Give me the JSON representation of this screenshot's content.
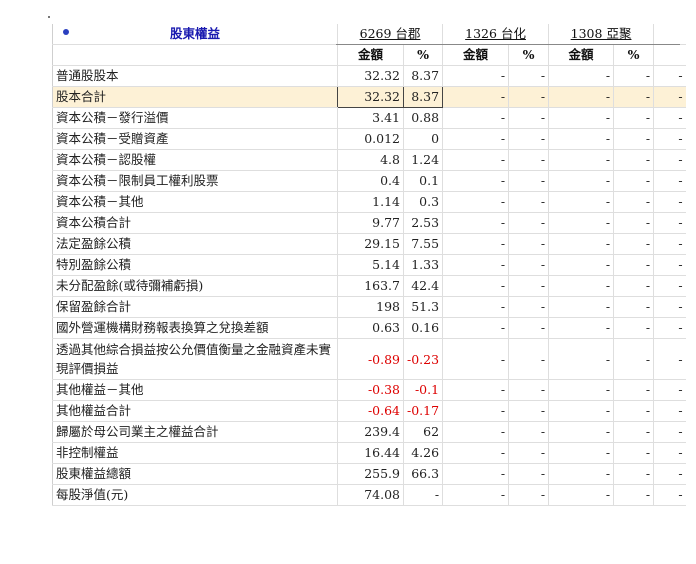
{
  "header": {
    "title": "股東權益",
    "companies": [
      "6269 台郡",
      "1326 台化",
      "1308 亞聚"
    ],
    "amount_label": "金額",
    "percent_label": "%"
  },
  "rows": [
    {
      "label": "普通股股本",
      "values": [
        "32.32",
        "8.37",
        "-",
        "-",
        "-",
        "-"
      ],
      "neg": false,
      "highlight": false
    },
    {
      "label": "股本合計",
      "values": [
        "32.32",
        "8.37",
        "-",
        "-",
        "-",
        "-"
      ],
      "neg": false,
      "highlight": true
    },
    {
      "label": "資本公積－發行溢價",
      "values": [
        "3.41",
        "0.88",
        "-",
        "-",
        "-",
        "-"
      ],
      "neg": false,
      "highlight": false
    },
    {
      "label": "資本公積－受贈資產",
      "values": [
        "0.012",
        "0",
        "-",
        "-",
        "-",
        "-"
      ],
      "neg": false,
      "highlight": false
    },
    {
      "label": "資本公積－認股權",
      "values": [
        "4.8",
        "1.24",
        "-",
        "-",
        "-",
        "-"
      ],
      "neg": false,
      "highlight": false
    },
    {
      "label": "資本公積－限制員工權利股票",
      "values": [
        "0.4",
        "0.1",
        "-",
        "-",
        "-",
        "-"
      ],
      "neg": false,
      "highlight": false
    },
    {
      "label": "資本公積－其他",
      "values": [
        "1.14",
        "0.3",
        "-",
        "-",
        "-",
        "-"
      ],
      "neg": false,
      "highlight": false
    },
    {
      "label": "資本公積合計",
      "values": [
        "9.77",
        "2.53",
        "-",
        "-",
        "-",
        "-"
      ],
      "neg": false,
      "highlight": false
    },
    {
      "label": "法定盈餘公積",
      "values": [
        "29.15",
        "7.55",
        "-",
        "-",
        "-",
        "-"
      ],
      "neg": false,
      "highlight": false
    },
    {
      "label": "特別盈餘公積",
      "values": [
        "5.14",
        "1.33",
        "-",
        "-",
        "-",
        "-"
      ],
      "neg": false,
      "highlight": false
    },
    {
      "label": "未分配盈餘(或待彌補虧損)",
      "values": [
        "163.7",
        "42.4",
        "-",
        "-",
        "-",
        "-"
      ],
      "neg": false,
      "highlight": false
    },
    {
      "label": "保留盈餘合計",
      "values": [
        "198",
        "51.3",
        "-",
        "-",
        "-",
        "-"
      ],
      "neg": false,
      "highlight": false
    },
    {
      "label": "國外營運機構財務報表換算之兌換差額",
      "values": [
        "0.63",
        "0.16",
        "-",
        "-",
        "-",
        "-"
      ],
      "neg": false,
      "highlight": false
    },
    {
      "label": "透過其他綜合損益按公允價值衡量之金融資產未實現評價損益",
      "values": [
        "-0.89",
        "-0.23",
        "-",
        "-",
        "-",
        "-"
      ],
      "neg": true,
      "highlight": false,
      "tall": true
    },
    {
      "label": "其他權益－其他",
      "values": [
        "-0.38",
        "-0.1",
        "-",
        "-",
        "-",
        "-"
      ],
      "neg": true,
      "highlight": false
    },
    {
      "label": "其他權益合計",
      "values": [
        "-0.64",
        "-0.17",
        "-",
        "-",
        "-",
        "-"
      ],
      "neg": true,
      "highlight": false
    },
    {
      "label": "歸屬於母公司業主之權益合計",
      "values": [
        "239.4",
        "62",
        "-",
        "-",
        "-",
        "-"
      ],
      "neg": false,
      "highlight": false
    },
    {
      "label": "非控制權益",
      "values": [
        "16.44",
        "4.26",
        "-",
        "-",
        "-",
        "-"
      ],
      "neg": false,
      "highlight": false
    },
    {
      "label": "股東權益總額",
      "values": [
        "255.9",
        "66.3",
        "-",
        "-",
        "-",
        "-"
      ],
      "neg": false,
      "highlight": false
    },
    {
      "label": "每股淨值(元)",
      "values": [
        "74.08",
        "-",
        "-",
        "-",
        "-",
        "-"
      ],
      "neg": false,
      "highlight": false
    }
  ]
}
